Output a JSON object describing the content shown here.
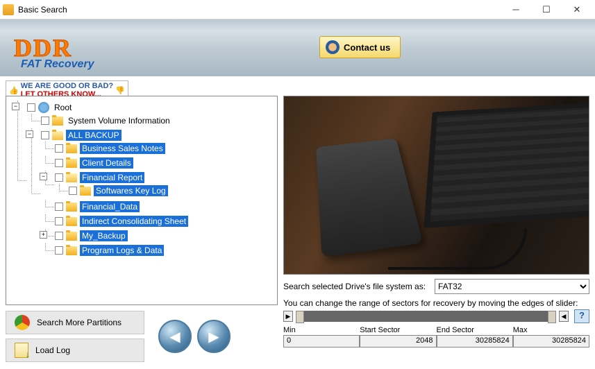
{
  "window": {
    "title": "Basic Search"
  },
  "banner": {
    "logo": "DDR",
    "subtitle": "FAT Recovery",
    "contact": "Contact us"
  },
  "feedback": {
    "line1": "WE ARE GOOD OR BAD?",
    "line2": "LET OTHERS KNOW..."
  },
  "tree": {
    "root": "Root",
    "items": [
      {
        "label": "System Volume Information"
      },
      {
        "label": "ALL BACKUP",
        "selected": true,
        "open": true,
        "children": [
          {
            "label": "Business Sales Notes"
          },
          {
            "label": "Client Details"
          },
          {
            "label": "Financial Report",
            "open": true,
            "children": [
              {
                "label": "Softwares Key Log"
              }
            ]
          },
          {
            "label": "Financial_Data"
          },
          {
            "label": "Indirect Consolidating Sheet"
          },
          {
            "label": "My_Backup",
            "expandable": true
          },
          {
            "label": "Program Logs & Data"
          }
        ]
      }
    ]
  },
  "buttons": {
    "search_more": "Search More Partitions",
    "load_log": "Load Log"
  },
  "fs": {
    "label": "Search selected Drive's file system as:",
    "value": "FAT32",
    "slider_note": "You can change the range of sectors for recovery by moving the edges of slider:"
  },
  "sectors": {
    "min_h": "Min",
    "min_v": "0",
    "start_h": "Start Sector",
    "start_v": "2048",
    "end_h": "End Sector",
    "end_v": "30285824",
    "max_h": "Max",
    "max_v": "30285824"
  }
}
